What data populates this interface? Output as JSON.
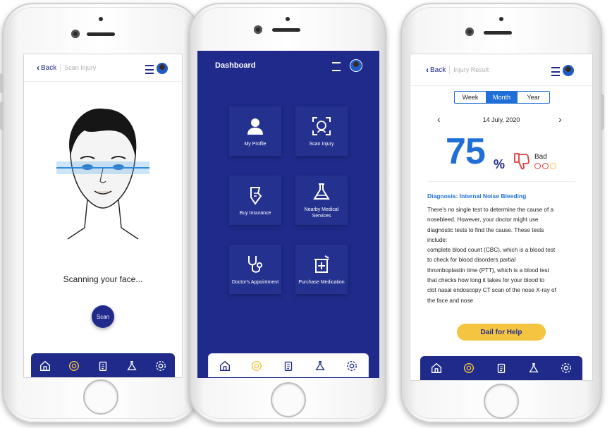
{
  "phone1": {
    "header": {
      "back_label": "Back",
      "crumb": "Scan Injury"
    },
    "status_text": "Scanning your face...",
    "scan_button": "Scan"
  },
  "phone2": {
    "header": {
      "title": "Dashboard"
    },
    "tiles": [
      {
        "label": "My Profile",
        "icon": "person-icon"
      },
      {
        "label": "Scan Injury",
        "icon": "face-scan-icon"
      },
      {
        "label": "Buy Insurance",
        "icon": "insurance-icon"
      },
      {
        "label": "Nearby Medical Services",
        "icon": "flask-icon"
      },
      {
        "label": "Doctor's Appointment",
        "icon": "stethoscope-icon"
      },
      {
        "label": "Purchase Medication",
        "icon": "medicine-icon"
      }
    ]
  },
  "phone3": {
    "header": {
      "back_label": "Back",
      "crumb": "Injury Result"
    },
    "period_tabs": [
      {
        "label": "Week",
        "active": false
      },
      {
        "label": "Month",
        "active": true
      },
      {
        "label": "Year",
        "active": false
      }
    ],
    "date": "14 July, 2020",
    "score": "75",
    "score_unit": "%",
    "rating_label": "Bad",
    "diagnosis_title": "Diagnosis: Internal Noise Bleeding",
    "diagnosis_body": [
      "There's no single test to determine the cause of a",
      "nosebleed. However, your doctor might use",
      "diagnostic tests to find the cause. These tests",
      "include:",
      "complete blood count (CBC), which is a blood test",
      "to check for blood disorders partial",
      "thromboplastin time (PTT), which is a blood test",
      "that checks how long it takes for your blood to",
      "clot nasal endoscopy CT scan of the nose X-ray of",
      "the face and nose"
    ],
    "help_button": "Dail for Help"
  },
  "nav_items": [
    "home-icon",
    "scan-icon",
    "clipboard-icon",
    "flask-icon",
    "settings-icon"
  ],
  "colors": {
    "brand": "#1f2a8a",
    "dashboard_bg": "#1f2a8a",
    "accent_blue": "#1f6fd6",
    "accent_yellow": "#f5c542",
    "bad_red": "#e23b3b"
  }
}
